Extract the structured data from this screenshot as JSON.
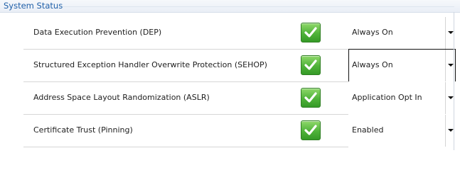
{
  "group": {
    "title": "System Status"
  },
  "rows": [
    {
      "label": "Data Execution Prevention (DEP)",
      "status_icon": "green-check-icon",
      "value": "Always On"
    },
    {
      "label": "Structured Exception Handler Overwrite Protection (SEHOP)",
      "status_icon": "green-check-icon",
      "value": "Always On"
    },
    {
      "label": "Address Space Layout Randomization (ASLR)",
      "status_icon": "green-check-icon",
      "value": "Application Opt In"
    },
    {
      "label": "Certificate Trust (Pinning)",
      "status_icon": "green-check-icon",
      "value": "Enabled"
    }
  ],
  "colors": {
    "header_text": "#1f5fa8",
    "check_green": "#4fb239"
  }
}
